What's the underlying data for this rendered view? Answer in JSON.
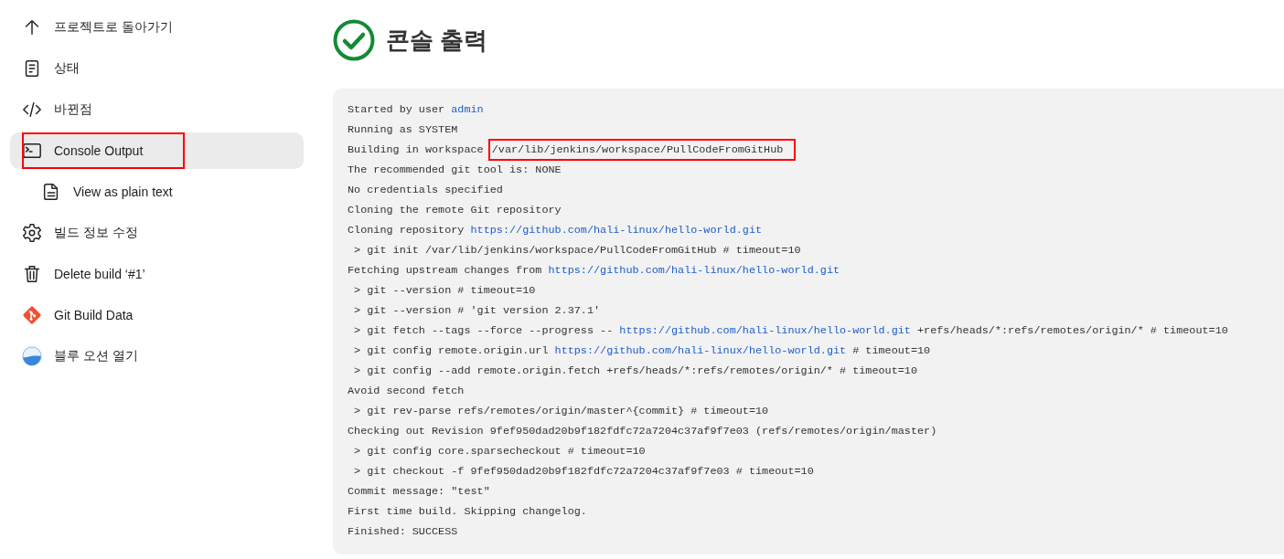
{
  "sidebar": {
    "items": [
      {
        "kind": "arrow-up",
        "label": "프로젝트로 돌아가기",
        "selected": false,
        "highlighted": false
      },
      {
        "kind": "document",
        "label": "상태",
        "selected": false,
        "highlighted": false
      },
      {
        "kind": "code",
        "label": "바뀐점",
        "selected": false,
        "highlighted": false
      },
      {
        "kind": "terminal",
        "label": "Console Output",
        "selected": true,
        "highlighted": true,
        "children": [
          {
            "kind": "file",
            "label": "View as plain text",
            "selected": false,
            "highlighted": false
          }
        ]
      },
      {
        "kind": "gear",
        "label": "빌드 정보 수정",
        "selected": false,
        "highlighted": false
      },
      {
        "kind": "trash",
        "label": "Delete build ‘#1’",
        "selected": false,
        "highlighted": false
      },
      {
        "kind": "git",
        "label": "Git Build Data",
        "selected": false,
        "highlighted": false
      },
      {
        "kind": "ocean",
        "label": "블루 오션 열기",
        "selected": false,
        "highlighted": false
      }
    ]
  },
  "header": {
    "title": "콘솔 출력"
  },
  "console": {
    "lines": [
      [
        {
          "kind": "text",
          "text": "Started by user "
        },
        {
          "kind": "link",
          "text": "admin"
        }
      ],
      [
        {
          "kind": "text",
          "text": "Running as SYSTEM"
        }
      ],
      [
        {
          "kind": "text",
          "text": "Building in workspace "
        },
        {
          "kind": "highlight",
          "text": "/var/lib/jenkins/workspace/PullCodeFromGitHub"
        }
      ],
      [
        {
          "kind": "text",
          "text": "The recommended git tool is: NONE"
        }
      ],
      [
        {
          "kind": "text",
          "text": "No credentials specified"
        }
      ],
      [
        {
          "kind": "text",
          "text": "Cloning the remote Git repository"
        }
      ],
      [
        {
          "kind": "text",
          "text": "Cloning repository "
        },
        {
          "kind": "link",
          "text": "https://github.com/hali-linux/hello-world.git"
        }
      ],
      [
        {
          "kind": "text",
          "text": " > git init /var/lib/jenkins/workspace/PullCodeFromGitHub # timeout=10"
        }
      ],
      [
        {
          "kind": "text",
          "text": "Fetching upstream changes from "
        },
        {
          "kind": "link",
          "text": "https://github.com/hali-linux/hello-world.git"
        }
      ],
      [
        {
          "kind": "text",
          "text": " > git --version # timeout=10"
        }
      ],
      [
        {
          "kind": "text",
          "text": " > git --version # 'git version 2.37.1'"
        }
      ],
      [
        {
          "kind": "text",
          "text": " > git fetch --tags --force --progress -- "
        },
        {
          "kind": "link",
          "text": "https://github.com/hali-linux/hello-world.git"
        },
        {
          "kind": "text",
          "text": " +refs/heads/*:refs/remotes/origin/* # timeout=10"
        }
      ],
      [
        {
          "kind": "text",
          "text": " > git config remote.origin.url "
        },
        {
          "kind": "link",
          "text": "https://github.com/hali-linux/hello-world.git"
        },
        {
          "kind": "text",
          "text": " # timeout=10"
        }
      ],
      [
        {
          "kind": "text",
          "text": " > git config --add remote.origin.fetch +refs/heads/*:refs/remotes/origin/* # timeout=10"
        }
      ],
      [
        {
          "kind": "text",
          "text": "Avoid second fetch"
        }
      ],
      [
        {
          "kind": "text",
          "text": " > git rev-parse refs/remotes/origin/master^{commit} # timeout=10"
        }
      ],
      [
        {
          "kind": "text",
          "text": "Checking out Revision 9fef950dad20b9f182fdfc72a7204c37af9f7e03 (refs/remotes/origin/master)"
        }
      ],
      [
        {
          "kind": "text",
          "text": " > git config core.sparsecheckout # timeout=10"
        }
      ],
      [
        {
          "kind": "text",
          "text": " > git checkout -f 9fef950dad20b9f182fdfc72a7204c37af9f7e03 # timeout=10"
        }
      ],
      [
        {
          "kind": "text",
          "text": "Commit message: \"test\""
        }
      ],
      [
        {
          "kind": "text",
          "text": "First time build. Skipping changelog."
        }
      ],
      [
        {
          "kind": "text",
          "text": "Finished: SUCCESS"
        }
      ]
    ]
  }
}
